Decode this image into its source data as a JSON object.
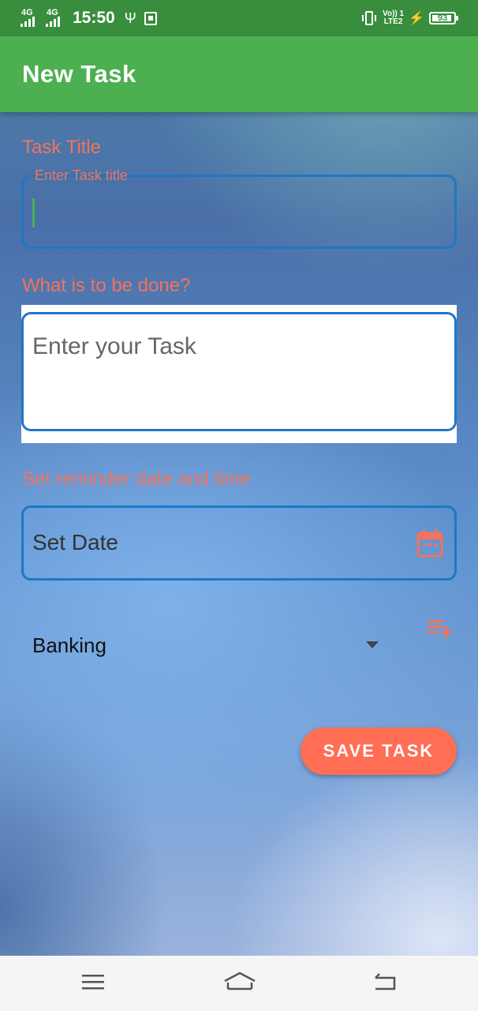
{
  "status_bar": {
    "network_1": "4G",
    "network_2": "4G",
    "time": "15:50",
    "volte_line1": "Vo)) 1",
    "volte_line2": "LTE2",
    "battery": "93",
    "battery_level": 0.93
  },
  "app_bar": {
    "title": "New Task"
  },
  "form": {
    "task_title_label": "Task Title",
    "task_title_floating_label": "Enter Task title",
    "task_title_value": "",
    "task_label": "What is to be done?",
    "task_placeholder": "Enter your Task",
    "reminder_label": "Set reminder date and time",
    "date_placeholder": "Set Date",
    "category_value": "Banking",
    "save_button": "SAVE TASK"
  },
  "colors": {
    "status_bar": "#388e3c",
    "app_bar": "#4caf50",
    "label": "#f4735b",
    "field_border": "#1f77c4",
    "button": "#ff6e55"
  },
  "icons": {
    "calendar": "calendar-icon",
    "add_list": "playlist-add-icon",
    "dropdown": "dropdown-arrow-icon",
    "nav_menu": "menu-icon",
    "nav_home": "home-icon",
    "nav_back": "back-icon"
  }
}
